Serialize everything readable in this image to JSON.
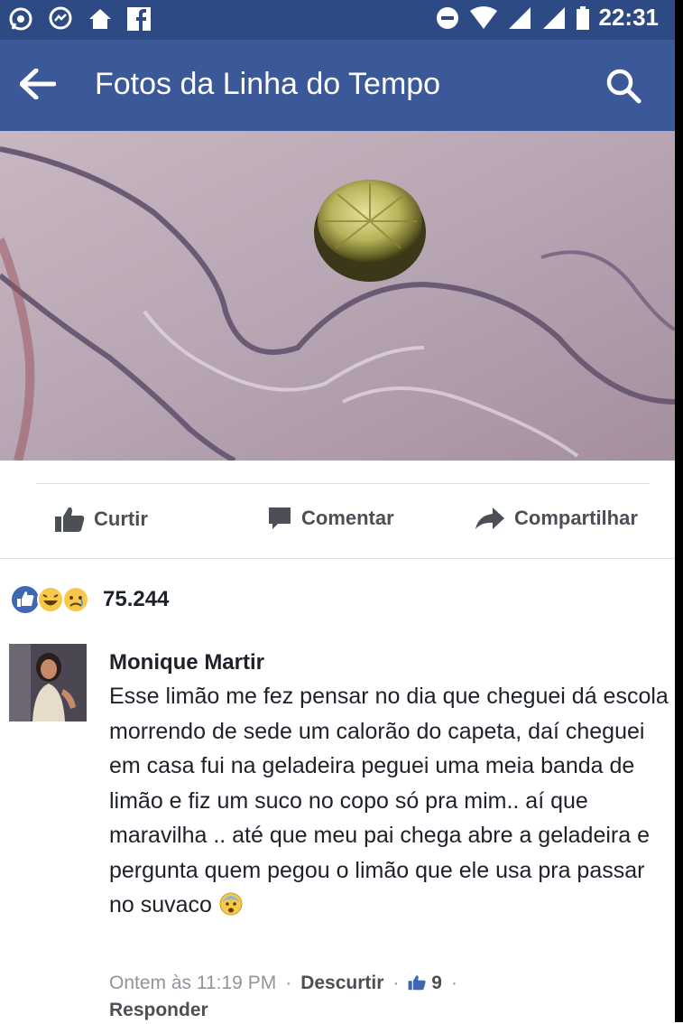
{
  "status_bar": {
    "time": "22:31",
    "left_icons": [
      "whatsapp-icon",
      "messenger-icon",
      "home-icon",
      "facebook-icon"
    ],
    "right_icons": [
      "do-not-disturb-icon",
      "wifi-icon",
      "signal-icon",
      "signal-icon",
      "battery-icon"
    ]
  },
  "app_bar": {
    "title": "Fotos da Linha do Tempo",
    "back_icon": "arrow-left-icon",
    "search_icon": "search-icon"
  },
  "actions": {
    "like": "Curtir",
    "comment": "Comentar",
    "share": "Compartilhar"
  },
  "reactions": {
    "types": [
      "like",
      "haha",
      "sad"
    ],
    "count": "75.244"
  },
  "comment": {
    "author": "Monique Martir",
    "text": "Esse limão me fez pensar no dia que cheguei dá escola morrendo de sede um calorão do capeta, daí cheguei em casa fui na geladeira peguei uma meia banda de limão e fiz um suco no copo só pra mim.. aí que maravilha .. até que meu pai chega abre a geladeira e pergunta quem pegou o limão que ele usa pra passar no suvaco",
    "emoji": "fearful-face-emoji",
    "timestamp": "Ontem às 11:19 PM",
    "unlike_label": "Descurtir",
    "like_count": "9",
    "reply_label": "Responder"
  },
  "colors": {
    "status_bar": "#2e4a84",
    "app_bar": "#3b5998",
    "like_blue": "#4267b2",
    "meta_grey": "#90949c"
  }
}
